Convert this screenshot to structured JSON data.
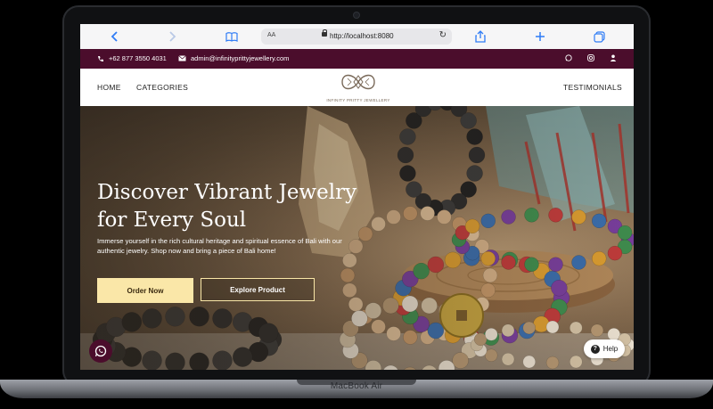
{
  "device": {
    "label": "MacBook Air"
  },
  "browser": {
    "text_size_label": "AA",
    "url": "http://localhost:8080"
  },
  "topbar": {
    "phone": "+62 877 3550 4031",
    "email": "admin@infinityprittyjewellery.com",
    "bg_color": "#4b0d2c"
  },
  "nav": {
    "home": "HOME",
    "categories": "CATEGORIES",
    "testimonials": "TESTIMONIALS",
    "logo_text": "INFINITY PRITTY JEWELLERY"
  },
  "hero": {
    "title_line1": "Discover Vibrant Jewelry",
    "title_line2": "for Every Soul",
    "description": "Immerse yourself in the rich cultural heritage and spiritual essence of Bali with our authentic jewelry. Shop now and bring a piece of Bali home!",
    "order_button": "Order Now",
    "explore_button": "Explore Product",
    "accent_color": "#fae7a8"
  },
  "help": {
    "label": "Help"
  }
}
